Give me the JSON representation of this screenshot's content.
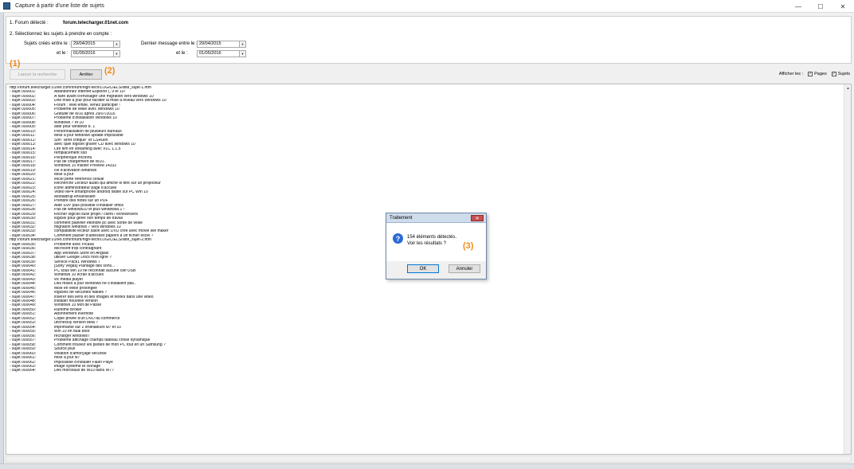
{
  "window": {
    "title": "Capture à partir d'une liste de sujets",
    "minimize": "—",
    "maximize": "☐",
    "close": "✕"
  },
  "steps": {
    "step1_label": "1.  Forum détecté :",
    "forum_name": "forum.telecharger.01net.com",
    "step2_label": "2.  Sélectionnez les sujets à prendre en compte :",
    "created_between_label": "Sujets créés entre le :",
    "created_and_label": "et le :",
    "last_msg_between_label": "Dernier message entre le :",
    "last_msg_and_label": "et le :",
    "created_from": "29/04/2015",
    "created_to": "01/05/2016",
    "last_from": "29/04/2015",
    "last_to": "01/05/2016"
  },
  "toolbar": {
    "launch_label": "Lancer la recherche",
    "stop_label": "Arrêter",
    "annotation_1": "(1)",
    "annotation_2": "(2)",
    "show_label": "Afficher les :",
    "pages_label": "Pages",
    "subjects_label": "Sujets"
  },
  "results": [
    "http://forum.telecharger.01net.com/forum/high-tech/LOGICIELS/liste_sujet-1.htm",
    [
      "- sujet 000001:",
      "Abandonnez Internet Explorer (, 9 et 10!"
    ],
    [
      "- sujet 000002:",
      "A faire avant d'envisager une migration vers windows 10"
    ],
    [
      "- sujet 000003:",
      "Une mise à jour pour faciliter la mise à niveau vers Windows 10"
    ],
    [
      "- sujet 000004:",
      "Forum : Wiki embe, venez participer !"
    ],
    [
      "- sujet 000005:",
      "Problème de veille avec Windows 10"
    ],
    [
      "- sujet 000006:",
      "Gratuité de W10 après 29/07/2016"
    ],
    [
      "- sujet 000007:",
      "Problème d'installation Windows 10"
    ],
    [
      "- sujet 000008:",
      "Windows 7 et 10"
    ],
    [
      "- sujet 000009:",
      "aide pour windows 8. 1"
    ],
    [
      "- sujet 000010:",
      "Personnalisation de plusieurs bureaux"
    ],
    [
      "- sujet 000011:",
      "Mise à jour windows update impossible"
    ],
    [
      "- sujet 000012:",
      "Son \"arrêt critique\" et CSRuon"
    ],
    [
      "- sujet 000013:",
      "avec quel logiciel graver CD avec windows 10"
    ],
    [
      "- sujet 000014:",
      "Lire film en streaming avec VLC 1.1.5"
    ],
    [
      "- sujet 000015:",
      "remplacement ssd"
    ],
    [
      "- sujet 000016:",
      "Périphérique inconnu"
    ],
    [
      "- sujet 000017:",
      "Pas de chargement de W10.."
    ],
    [
      "- sujet 000018:",
      "Windows 10 Insider Preview 14332"
    ],
    [
      "- sujet 000019:",
      "clé d'activation windows"
    ],
    [
      "- sujet 000020:",
      "Mise à jour"
    ],
    [
      "- sujet 000021:",
      "excel perte référence cellule"
    ],
    [
      "- sujet 000022:",
      "Recherche Lecteur audio qui affiche le titre sur un projecteur"
    ],
    [
      "- sujet 000023:",
      "icone administrateur page d'accueil"
    ],
    [
      "- sujet 000024:",
      "Video MP4 smartphone android lisible sur PC Win 10"
    ],
    [
      "- sujet 000025:",
      "Mobiadrup envahissant"
    ],
    [
      "- sujet 000026:",
      "Prendre des notes sur un PDF"
    ],
    [
      "- sujet 000027:",
      "Aide SVP plus possible d'installer office"
    ],
    [
      "- sujet 000028:",
      "Pas de windows10 et plus windows8.1 !"
    ],
    [
      "- sujet 000029:",
      "Rocher logiciel suivi projet / client / échéanciers"
    ],
    [
      "- sujet 000030:",
      "logiciel pour gérer son temps de travail"
    ],
    [
      "- sujet 000031:",
      "comment planifier éteindre pc avec sortie de veille"
    ],
    [
      "- sujet 000032:",
      "migration windows 7 vers windows 10"
    ],
    [
      "- sujet 000033:",
      "compatibilité lecteur salon avec DVD créé avec movie live maker"
    ],
    [
      "- sujet 000034:",
      "Comment passer d'adresses papiers à un fichier excel ?"
    ],
    "http://forum.telecharger.01net.com/forum/high-tech/LOGICIELS/liste_sujet-2.htm",
    [
      "- sujet 000035:",
      "Problème avec Picasa"
    ],
    [
      "- sujet 000036:",
      "Microsoft trop contraignant"
    ],
    [
      "- sujet 000037:",
      "App Windows Store en Anglais"
    ],
    [
      "- sujet 000038:",
      "utiliser Google Docs hors ligne ?"
    ],
    [
      "- sujet 000039:",
      "Service Pack1 Windows 7"
    ],
    [
      "- sujet 000040:",
      "[Sony Vegas] Plantage des sons..."
    ],
    [
      "- sujet 000041:",
      "PC sous win 10 ne reconnait aucune clef USB"
    ],
    [
      "- sujet 000042:",
      "Windows 10 écran d'accueil"
    ],
    [
      "- sujet 000043:",
      "vlc media player"
    ],
    [
      "- sujet 000044:",
      "Des mises à jour Windows ne s'installent pas.."
    ],
    [
      "- sujet 000045:",
      "Mise en veille prolongée"
    ],
    [
      "- sujet 000046:",
      "logiciels de sécurités fiables ?"
    ],
    [
      "- sujet 000047:",
      "insérer des liens et des images et textes dans une vidéo"
    ],
    [
      "- sujet 000048:",
      "installer nouvelle version"
    ],
    [
      "- sujet 000049:",
      "Windows 10 Mot de Passe"
    ],
    [
      "- sujet 000050:",
      "Runtime Broker"
    ],
    [
      "- sujet 000051:",
      "Abonnement evernote"
    ],
    [
      "- sujet 000052:",
      "Copie privée d'un DVD du commerce"
    ],
    [
      "- sujet 000053:",
      "uncheckly version beta ?"
    ],
    [
      "- sujet 000054:",
      "imprimante sur 2 ordinateurs w7 et 10"
    ],
    [
      "- sujet 000055:",
      "Win 10 en dual boot"
    ],
    [
      "- sujet 000056:",
      "recharger windows7"
    ],
    [
      "- sujet 000057:",
      "Problème affichage champs tableau croisé dynamique"
    ],
    [
      "- sujet 000058:",
      "Comment trouvez les pilotes de mon PC tout en un Samsung ?"
    ],
    [
      "- sujet 000059:",
      "Source jeux"
    ],
    [
      "- sujet 000060:",
      "violation d'amorçage sécurisé"
    ],
    [
      "- sujet 000061:",
      "mise à jour w7"
    ],
    [
      "- sujet 000062:",
      "Impossible d'installer Flash Playe"
    ],
    [
      "- sujet 000063:",
      "image système et clonage"
    ],
    [
      "- sujet 000064:",
      "Des morceaux de W10 dans W7?"
    ]
  ],
  "dialog": {
    "title": "Traitement",
    "close": "✕",
    "icon": "?",
    "line1": "154 éléments détectés.",
    "line2": "Voir les résultats ?",
    "annotation_3": "(3)",
    "ok": "OK",
    "cancel": "Annuler"
  },
  "colors": {
    "annotation": "#ef8a18",
    "accent": "#0078d7"
  }
}
